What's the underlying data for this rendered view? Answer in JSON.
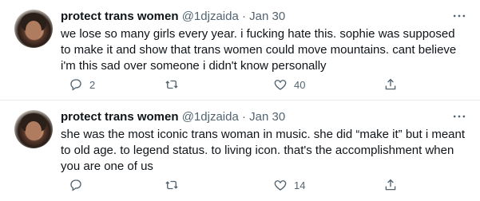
{
  "tweets": [
    {
      "name": "protect trans women",
      "handle": "@1djzaida",
      "sep": "·",
      "date": "Jan 30",
      "text": "we lose so many girls every year. i fucking hate this. sophie was supposed to make it and show that trans women could move mountains. cant believe i'm this sad over someone i didn't know personally",
      "replies": "2",
      "retweets": "",
      "likes": "40"
    },
    {
      "name": "protect trans women",
      "handle": "@1djzaida",
      "sep": "·",
      "date": "Jan 30",
      "text": "she was the most iconic trans woman in music. she did “make it” but i meant to old age. to legend status. to living icon. that's the accomplishment when you are one of us",
      "replies": "",
      "retweets": "",
      "likes": "14"
    }
  ],
  "icons": {
    "avatar": "profile-photo",
    "more": "more-dots-icon",
    "reply": "reply-bubble-icon",
    "retweet": "retweet-icon",
    "like": "heart-icon",
    "share": "share-icon"
  },
  "colors": {
    "text": "#0f1419",
    "secondary": "#536471",
    "divider": "#e6ecf0"
  }
}
